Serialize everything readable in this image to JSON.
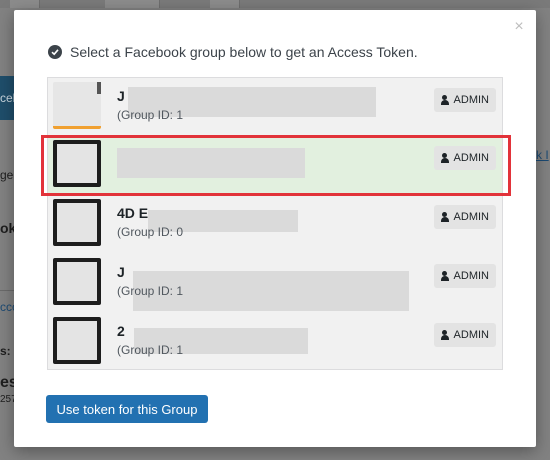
{
  "background": {
    "left_button_text": "ceb",
    "fragments": [
      "ge",
      "oke",
      "cco",
      "s:",
      "es",
      "257"
    ],
    "link_text": "k I"
  },
  "modal": {
    "close_glyph": "×",
    "heading": "Select a Facebook group below to get an Access Token.",
    "groups": [
      {
        "name": "J",
        "group_id": "(Group ID: 1",
        "badge": "ADMIN"
      },
      {
        "name": "",
        "group_id": "",
        "badge": "ADMIN"
      },
      {
        "name": "4D E",
        "group_id": "(Group ID: 0",
        "badge": "ADMIN"
      },
      {
        "name": "J",
        "group_id": "(Group ID: 1",
        "badge": "ADMIN"
      },
      {
        "name": "2",
        "group_id": "(Group ID: 1",
        "badge": "ADMIN"
      }
    ],
    "button_label": "Use token for this Group"
  },
  "colors": {
    "highlight": "#e2333a",
    "primary": "#2271b1",
    "selected_row": "#e2f0df"
  },
  "icons": [
    "check-circle-icon",
    "user-icon",
    "close-icon"
  ]
}
